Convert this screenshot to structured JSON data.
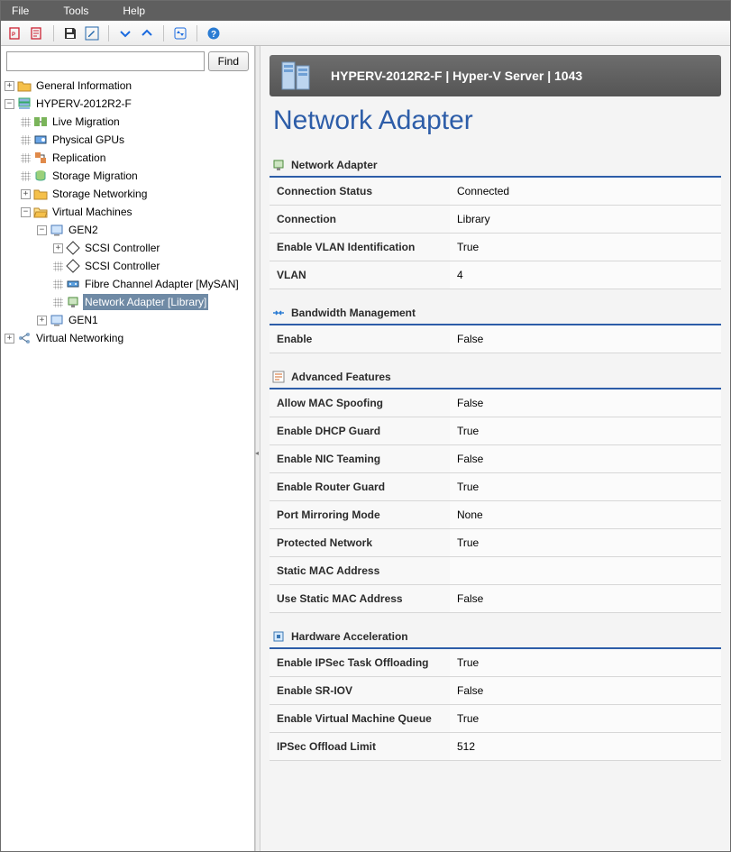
{
  "menubar": {
    "file": "File",
    "tools": "Tools",
    "help": "Help"
  },
  "find": {
    "placeholder": "",
    "button": "Find"
  },
  "tree": {
    "root1": "General Information",
    "host": "HYPERV-2012R2-F",
    "live_migration": "Live Migration",
    "physical_gpus": "Physical GPUs",
    "replication": "Replication",
    "storage_migration": "Storage Migration",
    "storage_networking": "Storage Networking",
    "virtual_machines": "Virtual Machines",
    "gen2": "GEN2",
    "scsi1": "SCSI Controller",
    "scsi2": "SCSI Controller",
    "fc_adapter": "Fibre Channel Adapter [MySAN]",
    "net_adapter": "Network Adapter [Library]",
    "gen1": "GEN1",
    "virt_net": "Virtual Networking"
  },
  "header": {
    "title": "HYPERV-2012R2-F | Hyper-V Server | 1043"
  },
  "page": {
    "title": "Network Adapter"
  },
  "sections": {
    "network_adapter": {
      "title": "Network Adapter",
      "rows": {
        "connection_status_k": "Connection Status",
        "connection_status_v": "Connected",
        "connection_k": "Connection",
        "connection_v": "Library",
        "enable_vlan_k": "Enable VLAN Identification",
        "enable_vlan_v": "True",
        "vlan_k": "VLAN",
        "vlan_v": "4"
      }
    },
    "bandwidth": {
      "title": "Bandwidth Management",
      "rows": {
        "enable_k": "Enable",
        "enable_v": "False"
      }
    },
    "advanced": {
      "title": "Advanced Features",
      "rows": {
        "mac_spoof_k": "Allow MAC Spoofing",
        "mac_spoof_v": "False",
        "dhcp_k": "Enable DHCP Guard",
        "dhcp_v": "True",
        "nic_team_k": "Enable NIC Teaming",
        "nic_team_v": "False",
        "router_k": "Enable Router Guard",
        "router_v": "True",
        "port_mirror_k": "Port Mirroring Mode",
        "port_mirror_v": "None",
        "protected_k": "Protected Network",
        "protected_v": "True",
        "static_mac_k": "Static MAC Address",
        "static_mac_v": "",
        "use_static_mac_k": "Use Static MAC Address",
        "use_static_mac_v": "False"
      }
    },
    "hardware": {
      "title": "Hardware Acceleration",
      "rows": {
        "ipsec_k": "Enable IPSec Task Offloading",
        "ipsec_v": "True",
        "sriov_k": "Enable SR-IOV",
        "sriov_v": "False",
        "vmq_k": "Enable Virtual Machine Queue",
        "vmq_v": "True",
        "ipsec_limit_k": "IPSec Offload Limit",
        "ipsec_limit_v": "512"
      }
    }
  }
}
